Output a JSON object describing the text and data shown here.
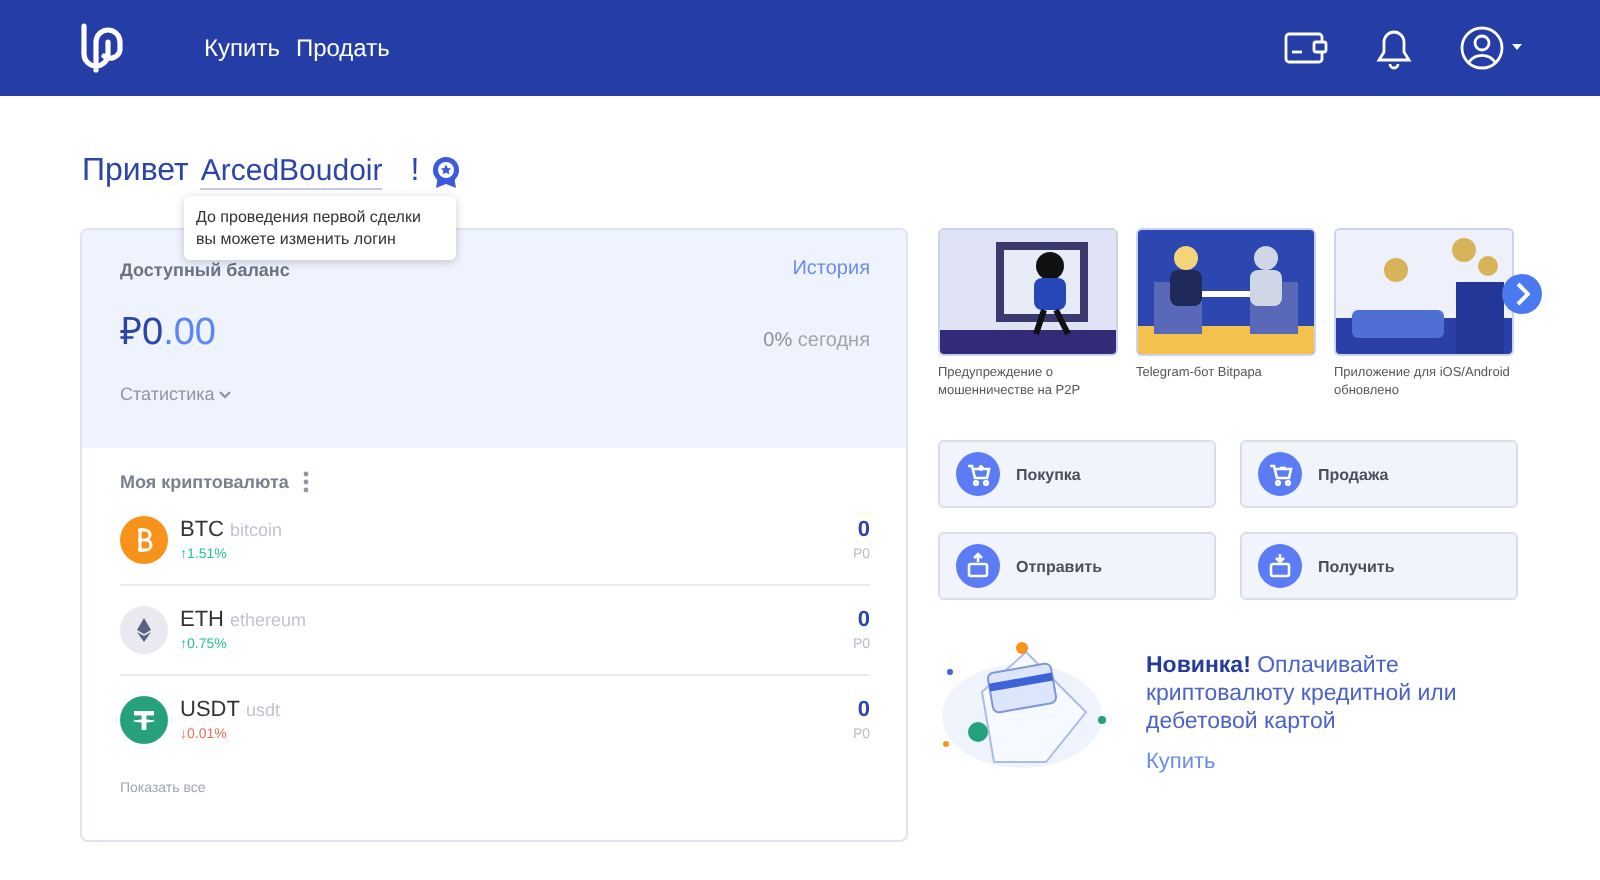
{
  "header": {
    "nav": [
      "Купить",
      "Продать"
    ]
  },
  "greeting": {
    "text": "Привет",
    "username": "ArcedBoudoir",
    "exclaim": "!",
    "tooltip": "До проведения первой сделки вы можете изменить логин"
  },
  "balance": {
    "title": "Доступный баланс",
    "history_link": "История",
    "amount": "₽0",
    "fraction": ".00",
    "change": "0%",
    "change_label": "сегодня",
    "stats": "Статистика"
  },
  "crypto": {
    "title": "Моя криптовалюта",
    "show_all": "Показать все",
    "items": [
      {
        "kind": "btc",
        "color": "#f7931a",
        "symbol": "BTC",
        "name": "bitcoin",
        "rising": true,
        "change": "↑1.51%",
        "amount": "0",
        "fiat": "Р0"
      },
      {
        "kind": "eth",
        "color": "#e8eaf0",
        "symbol": "ETH",
        "name": "ethereum",
        "rising": true,
        "change": "↑0.75%",
        "amount": "0",
        "fiat": "Р0"
      },
      {
        "kind": "usdt",
        "color": "#26a17b",
        "symbol": "USDT",
        "name": "usdt",
        "rising": false,
        "change": "↓0.01%",
        "amount": "0",
        "fiat": "Р0"
      }
    ]
  },
  "news": [
    {
      "caption": "Предупреждение о мошенничестве на P2P"
    },
    {
      "caption": "Telegram-бот Bitpapa"
    },
    {
      "caption": "Приложение для iOS/Android обновлено"
    }
  ],
  "actions": [
    {
      "kind": "buy",
      "label": "Покупка"
    },
    {
      "kind": "sell",
      "label": "Продажа"
    },
    {
      "kind": "send",
      "label": "Отправить"
    },
    {
      "kind": "receive",
      "label": "Получить"
    }
  ],
  "promo": {
    "text": "**Новинка!** Оплачивайте криптовалюту кредитной или дебетовой картой",
    "link": "Купить"
  }
}
